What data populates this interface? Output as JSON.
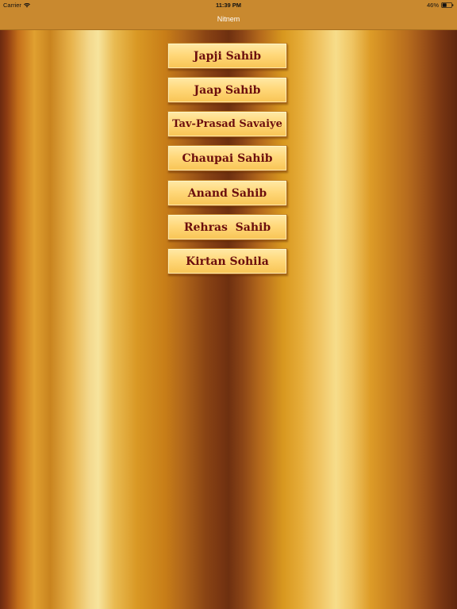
{
  "status_bar": {
    "carrier": "Carrier",
    "time": "11:39 PM",
    "battery": "46%",
    "icons": [
      "wifi-icon",
      "battery-icon"
    ]
  },
  "nav": {
    "title": "Nitnem"
  },
  "colors": {
    "bar_background": "#c9892f",
    "button_text": "#6b0e0e",
    "button_face": "#ffd87a",
    "nav_title": "#ffffff"
  },
  "menu": {
    "items": [
      {
        "label": "Japji Sahib"
      },
      {
        "label": "Jaap Sahib"
      },
      {
        "label": "Tav-Prasad Savaiye"
      },
      {
        "label": "Chaupai Sahib"
      },
      {
        "label": "Anand Sahib"
      },
      {
        "label": "Rehras  Sahib"
      },
      {
        "label": "Kirtan Sohila"
      }
    ]
  }
}
